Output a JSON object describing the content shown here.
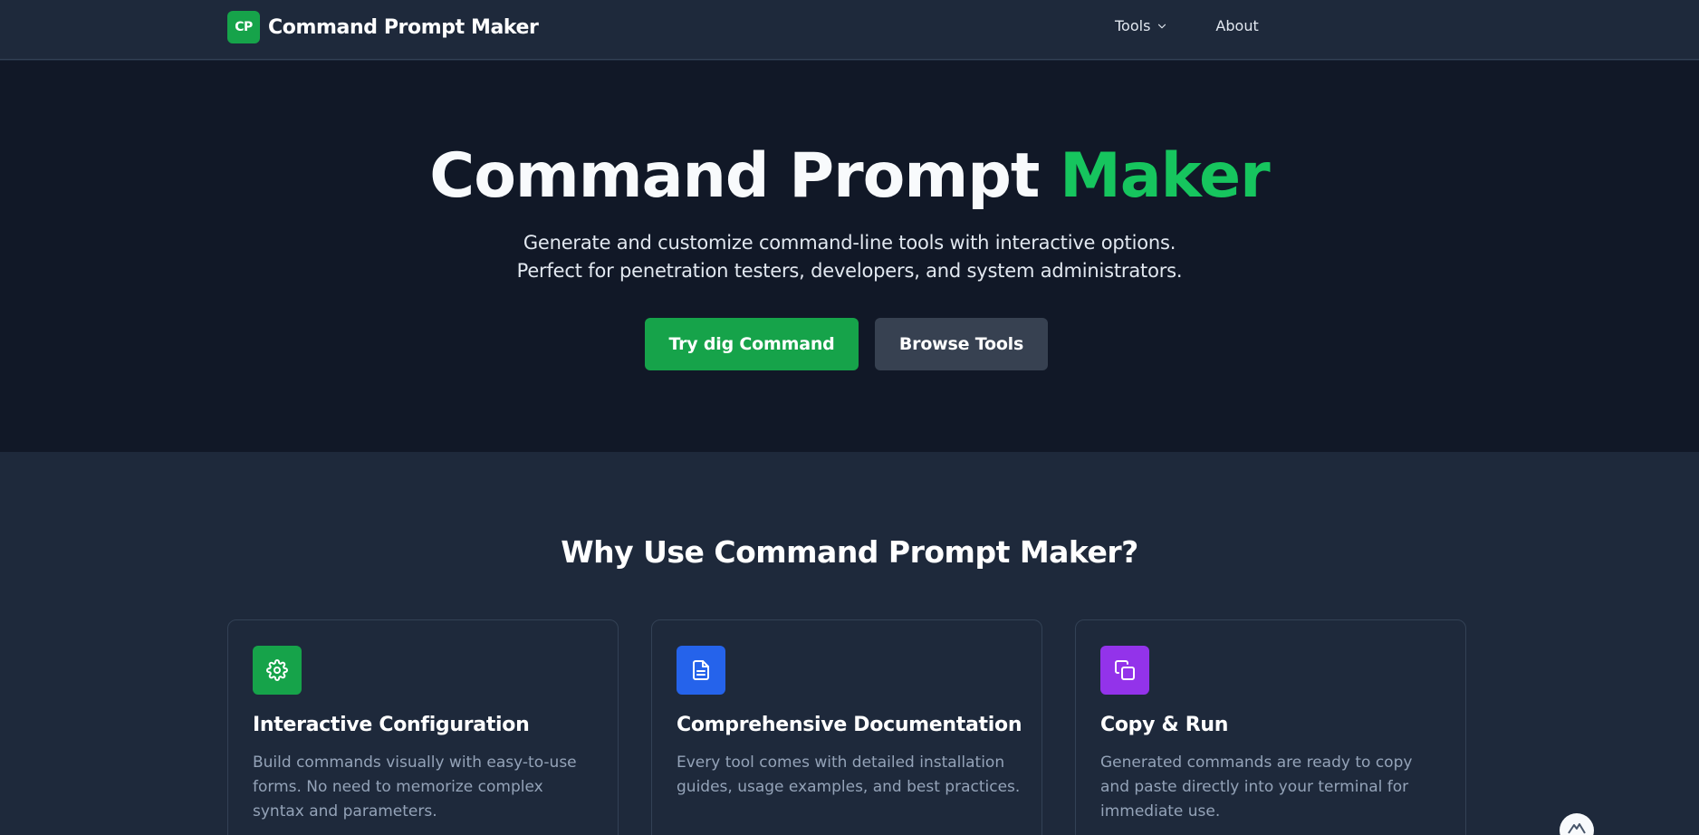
{
  "nav": {
    "logo_text": "CP",
    "brand": "Command Prompt Maker",
    "tools_label": "Tools",
    "about_label": "About"
  },
  "hero": {
    "title_main": "Command Prompt ",
    "title_accent": "Maker",
    "subtitle_line1": "Generate and customize command-line tools with interactive options.",
    "subtitle_line2": "Perfect for penetration testers, developers, and system administrators.",
    "primary_button": "Try dig Command",
    "secondary_button": "Browse Tools"
  },
  "features": {
    "title": "Why Use Command Prompt Maker?",
    "cards": [
      {
        "title": "Interactive Configuration",
        "description": "Build commands visually with easy-to-use forms. No need to memorize complex syntax and parameters.",
        "icon": "gear-icon",
        "color": "#16a34a"
      },
      {
        "title": "Comprehensive Documentation",
        "description": "Every tool comes with detailed installation guides, usage examples, and best practices.",
        "icon": "document-icon",
        "color": "#2563eb"
      },
      {
        "title": "Copy & Run",
        "description": "Generated commands are ready to copy and paste directly into your terminal for immediate use.",
        "icon": "copy-icon",
        "color": "#9333ea"
      }
    ]
  },
  "colors": {
    "accent": "#16c55e",
    "hero_bg": "#111827",
    "page_bg": "#1e293b"
  }
}
